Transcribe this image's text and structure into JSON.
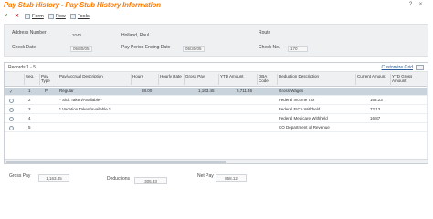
{
  "window": {
    "title": "Pay Stub History - Pay Stub History Information"
  },
  "toolbar": {
    "ok_label": "Form",
    "cancel_label": "Row",
    "tools_label": "Tools"
  },
  "header": {
    "address_number_label": "Address Number",
    "address_number_value": "2040",
    "name_value": "Holland, Raul",
    "route_label": "Route",
    "check_date_label": "Check Date",
    "check_date_value": "05/30/05",
    "pay_period_label": "Pay Period Ending Date",
    "pay_period_value": "05/30/05",
    "check_no_label": "Check No.",
    "check_no_value": "170"
  },
  "grid": {
    "records_label": "Records 1 - 5",
    "customize_label": "Customize Grid",
    "columns": [
      {
        "key": "seq",
        "label": "Seq."
      },
      {
        "key": "pay_type",
        "label": "Pay Type"
      },
      {
        "key": "pay_desc",
        "label": "Pay/Accrual Description"
      },
      {
        "key": "hours",
        "label": "Hours"
      },
      {
        "key": "rate",
        "label": "Hourly Rate"
      },
      {
        "key": "gross",
        "label": "Gross Pay"
      },
      {
        "key": "ytd",
        "label": "YTD Amount"
      },
      {
        "key": "dba",
        "label": "DBA Code"
      },
      {
        "key": "deduction",
        "label": "Deduction Description"
      },
      {
        "key": "current",
        "label": "Current Amount"
      },
      {
        "key": "ytdgross",
        "label": "YTD Gross Amount"
      }
    ],
    "rows": [
      {
        "seq": "1",
        "pay_type": "P",
        "pay_desc": "Regular",
        "hours": "88.00",
        "rate": "",
        "gross": "1,163.45",
        "ytd": "5,711.46",
        "dba": "",
        "deduction": "Gross Wages",
        "current": "",
        "ytdgross": ""
      },
      {
        "seq": "2",
        "pay_type": "",
        "pay_desc": "* Sick Taken/Available *",
        "hours": "",
        "rate": "",
        "gross": "",
        "ytd": "",
        "dba": "",
        "deduction": "Federal Income Tax",
        "current": "163.23",
        "ytdgross": ""
      },
      {
        "seq": "3",
        "pay_type": "",
        "pay_desc": "* Vacation Taken/Available *",
        "hours": "",
        "rate": "",
        "gross": "",
        "ytd": "",
        "dba": "",
        "deduction": "Federal FICA Withheld",
        "current": "72.13",
        "ytdgross": ""
      },
      {
        "seq": "4",
        "pay_type": "",
        "pay_desc": "",
        "hours": "",
        "rate": "",
        "gross": "",
        "ytd": "",
        "dba": "",
        "deduction": "Federal Medicare Withheld",
        "current": "16.87",
        "ytdgross": ""
      },
      {
        "seq": "5",
        "pay_type": "",
        "pay_desc": "",
        "hours": "",
        "rate": "",
        "gross": "",
        "ytd": "",
        "dba": "",
        "deduction": "CO Department of Revenue",
        "current": "",
        "ytdgross": ""
      }
    ]
  },
  "totals": {
    "gross_pay_label": "Gross Pay",
    "gross_pay_value": "1,163.45",
    "deductions_label": "Deductions",
    "deductions_value": "305.33",
    "net_pay_label": "Net Pay",
    "net_pay_value": "858.12"
  }
}
